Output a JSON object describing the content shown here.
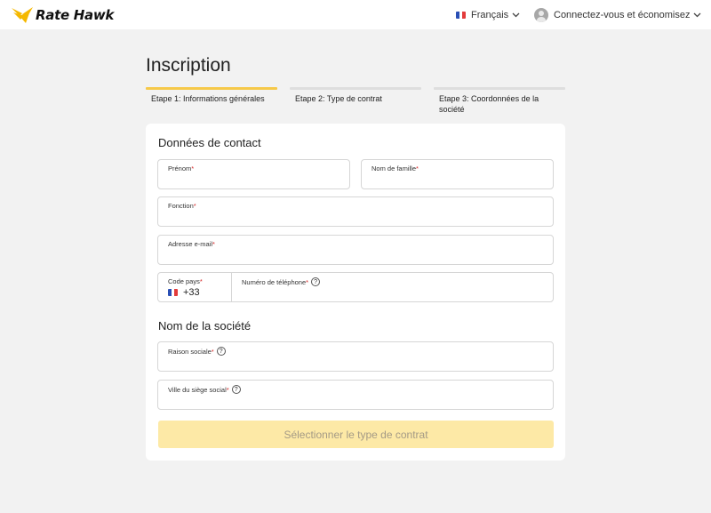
{
  "header": {
    "logo_text": "Rate Hawk",
    "language": "Français",
    "account_label": "Connectez-vous et économisez"
  },
  "page": {
    "title": "Inscription"
  },
  "steps": [
    {
      "label": "Etape 1: Informations générales",
      "active": true
    },
    {
      "label": "Etape 2: Type de contrat",
      "active": false
    },
    {
      "label": "Etape 3: Coordonnées de la société",
      "active": false
    }
  ],
  "contact": {
    "title": "Données de contact",
    "first_name": {
      "label": "Prénom",
      "value": ""
    },
    "last_name": {
      "label": "Nom de famille",
      "value": ""
    },
    "position": {
      "label": "Fonction",
      "value": ""
    },
    "email": {
      "label": "Adresse e-mail",
      "value": ""
    },
    "country_code": {
      "label": "Code pays",
      "value": "+33"
    },
    "phone": {
      "label": "Numéro de téléphone",
      "value": ""
    }
  },
  "company": {
    "title": "Nom de la société",
    "legal_name": {
      "label": "Raison sociale",
      "value": ""
    },
    "hq_city": {
      "label": "Ville du siège social",
      "value": ""
    }
  },
  "actions": {
    "submit_label": "Sélectionner le type de contrat"
  },
  "colors": {
    "accent": "#f6c949",
    "button_disabled_bg": "#fde9a6",
    "required": "#d62828"
  }
}
